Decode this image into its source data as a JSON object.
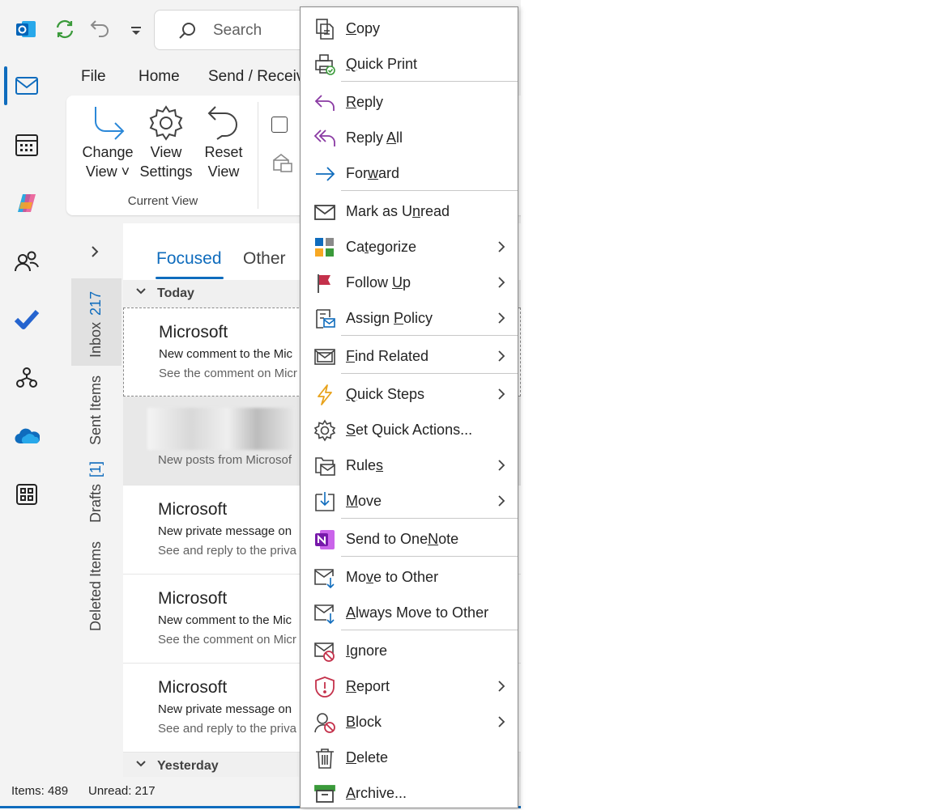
{
  "colors": {
    "accent": "#0f6cbd",
    "reply_purple": "#8a3aa3",
    "danger": "#c4314b"
  },
  "titlebar": {
    "search_placeholder": "Search"
  },
  "menu_tabs": [
    "File",
    "Home",
    "Send / Receive"
  ],
  "ribbon": {
    "buttons": [
      {
        "line1": "Change",
        "line2": "View ˅"
      },
      {
        "line1": "View",
        "line2": "Settings"
      },
      {
        "line1": "Reset",
        "line2": "View"
      }
    ],
    "group_label": "Current View"
  },
  "folders": [
    {
      "label": "Inbox",
      "count": "217"
    },
    {
      "label": "Sent Items",
      "count": ""
    },
    {
      "label": "Drafts",
      "count": "[1]"
    },
    {
      "label": "Deleted Items",
      "count": ""
    }
  ],
  "tabs": {
    "focused": "Focused",
    "other": "Other"
  },
  "groups": {
    "today": "Today",
    "yesterday": "Yesterday"
  },
  "messages": [
    {
      "from": "Microsoft",
      "subject": "New comment to the Mic",
      "preview": "See the comment on Micr"
    },
    {
      "from": "",
      "subject": "",
      "preview": "New posts from Microsof"
    },
    {
      "from": "Microsoft",
      "subject": "New private message on",
      "preview": "See and reply to the priva"
    },
    {
      "from": "Microsoft",
      "subject": "New comment to the Mic",
      "preview": "See the comment on Micr"
    },
    {
      "from": "Microsoft",
      "subject": "New private message on",
      "preview": "See and reply to the priva"
    }
  ],
  "status": {
    "items": "Items: 489",
    "unread": "Unread: 217"
  },
  "context_menu": [
    {
      "id": "copy",
      "pre": "",
      "key": "C",
      "post": "opy",
      "sub": false
    },
    {
      "id": "quick-print",
      "pre": "",
      "key": "Q",
      "post": "uick Print",
      "sub": false
    },
    {
      "id": "reply",
      "pre": "",
      "key": "R",
      "post": "eply",
      "sub": false
    },
    {
      "id": "reply-all",
      "pre": "Reply ",
      "key": "A",
      "post": "ll",
      "sub": false
    },
    {
      "id": "forward",
      "pre": "For",
      "key": "w",
      "post": "ard",
      "sub": false
    },
    {
      "id": "mark-unread",
      "pre": "Mark as U",
      "key": "n",
      "post": "read",
      "sub": false
    },
    {
      "id": "categorize",
      "pre": "Ca",
      "key": "t",
      "post": "egorize",
      "sub": true
    },
    {
      "id": "follow-up",
      "pre": "Follow ",
      "key": "U",
      "post": "p",
      "sub": true
    },
    {
      "id": "assign-policy",
      "pre": "Assign ",
      "key": "P",
      "post": "olicy",
      "sub": true
    },
    {
      "id": "find-related",
      "pre": "",
      "key": "F",
      "post": "ind Related",
      "sub": true
    },
    {
      "id": "quick-steps",
      "pre": "",
      "key": "Q",
      "post": "uick Steps",
      "sub": true
    },
    {
      "id": "set-quick-actions",
      "pre": "",
      "key": "S",
      "post": "et Quick Actions...",
      "sub": false
    },
    {
      "id": "rules",
      "pre": "Rule",
      "key": "s",
      "post": "",
      "sub": true
    },
    {
      "id": "move",
      "pre": "",
      "key": "M",
      "post": "ove",
      "sub": true
    },
    {
      "id": "send-onenote",
      "pre": "Send to One",
      "key": "N",
      "post": "ote",
      "sub": false
    },
    {
      "id": "move-other",
      "pre": "Mo",
      "key": "v",
      "post": "e to Other",
      "sub": false
    },
    {
      "id": "always-move-other",
      "pre": "",
      "key": "A",
      "post": "lways Move to Other",
      "sub": false
    },
    {
      "id": "ignore",
      "pre": "",
      "key": "I",
      "post": "gnore",
      "sub": false
    },
    {
      "id": "report",
      "pre": "",
      "key": "R",
      "post": "eport",
      "sub": true
    },
    {
      "id": "block",
      "pre": "",
      "key": "B",
      "post": "lock",
      "sub": true
    },
    {
      "id": "delete",
      "pre": "",
      "key": "D",
      "post": "elete",
      "sub": false
    },
    {
      "id": "archive",
      "pre": "",
      "key": "A",
      "post": "rchive...",
      "sub": false
    }
  ]
}
